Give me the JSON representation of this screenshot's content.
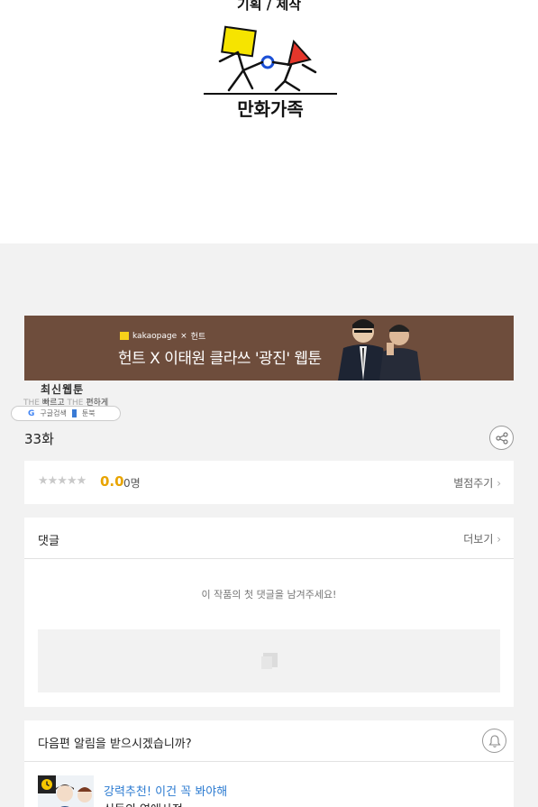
{
  "header": {
    "credit": "기획 / 제작",
    "logo_text": "만화가족"
  },
  "banner": {
    "brand": "kakaopage",
    "brand_x": "×",
    "brand_partner": "헌트",
    "title": "헌트 X 이태원 클라쓰 '광진' 웹툰"
  },
  "webtoon_tag": {
    "title": "최신웹툰",
    "sub_faint1": "THE",
    "sub_bold1": "빠르고",
    "sub_faint2": "THE",
    "sub_bold2": "편하게",
    "pill_google": "구글검색",
    "pill_site": "툰북"
  },
  "episode": {
    "title": "33화"
  },
  "rating": {
    "stars": "★★★★★",
    "score": "0.0",
    "count": "0명",
    "action": "별점주기"
  },
  "comments": {
    "title": "댓글",
    "more": "더보기",
    "empty": "이 작품의 첫 댓글을 남겨주세요!"
  },
  "notify": {
    "title": "다음편 알림을 받으시겠습니까?",
    "rec_label": "강력추천! 이건 꼭 봐야해",
    "rec_sub": "신동의 연애사정"
  },
  "colors": {
    "banner_bg": "#6e4d3c",
    "score": "#e8a400",
    "link_blue": "#2c7bd1"
  }
}
